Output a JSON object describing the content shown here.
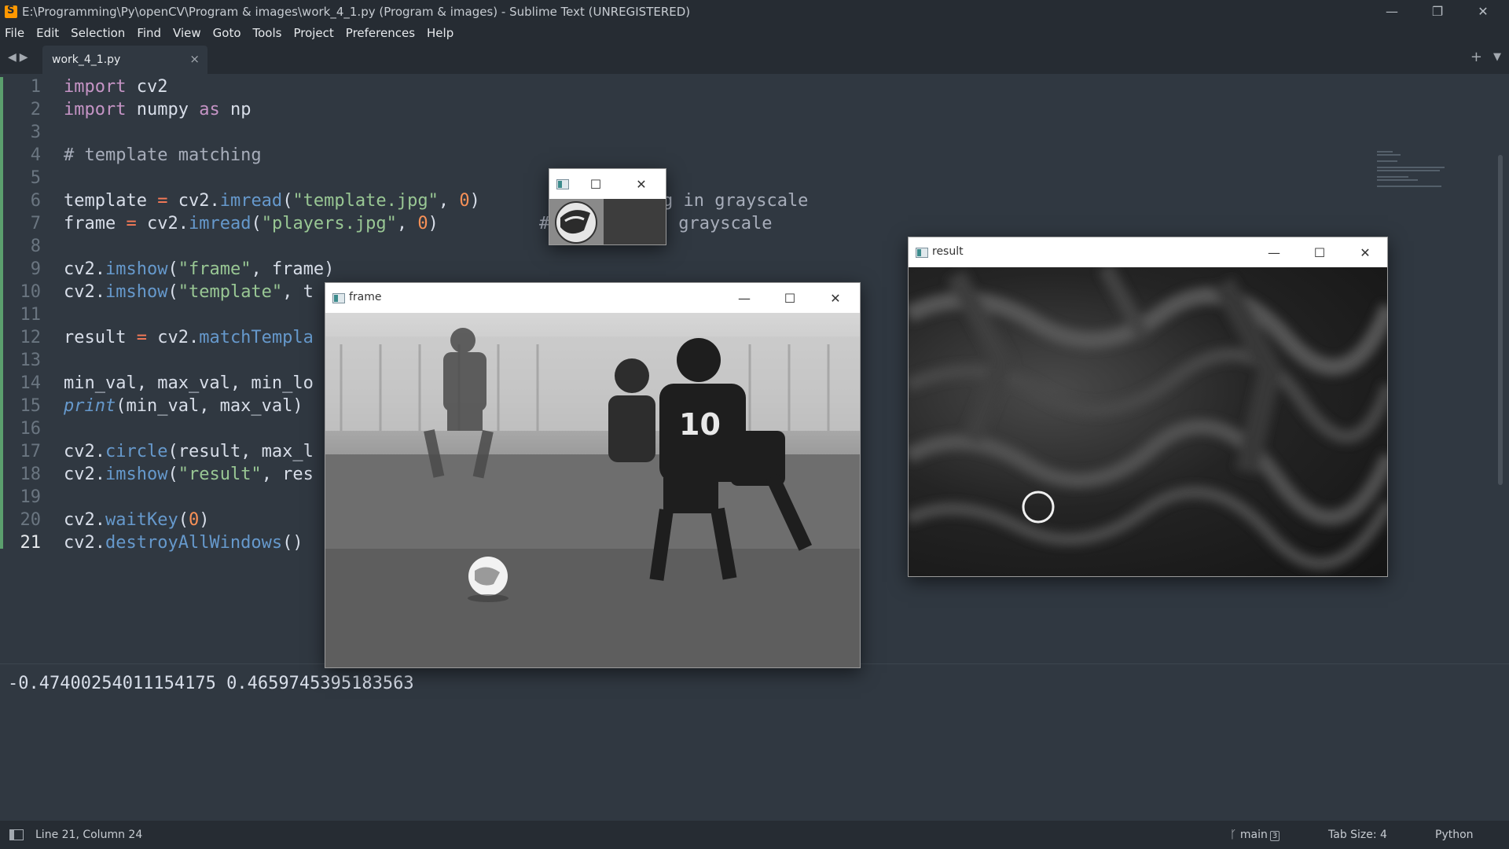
{
  "titlebar": {
    "title": "E:\\Programming\\Py\\openCV\\Program & images\\work_4_1.py (Program & images) - Sublime Text (UNREGISTERED)",
    "minimize_glyph": "—",
    "maximize_glyph": "❐",
    "close_glyph": "✕"
  },
  "menu": [
    "File",
    "Edit",
    "Selection",
    "Find",
    "View",
    "Goto",
    "Tools",
    "Project",
    "Preferences",
    "Help"
  ],
  "tabs": {
    "nav_glyph": "◀▶",
    "active_label": "work_4_1.py",
    "close_glyph": "×",
    "plus_glyph": "+",
    "dropdown_glyph": "▼"
  },
  "editor": {
    "current_line": 21,
    "lines": [
      {
        "n": "1"
      },
      {
        "n": "2"
      },
      {
        "n": "3"
      },
      {
        "n": "4"
      },
      {
        "n": "5"
      },
      {
        "n": "6"
      },
      {
        "n": "7"
      },
      {
        "n": "8"
      },
      {
        "n": "9"
      },
      {
        "n": "10"
      },
      {
        "n": "11"
      },
      {
        "n": "12"
      },
      {
        "n": "13"
      },
      {
        "n": "14"
      },
      {
        "n": "15"
      },
      {
        "n": "16"
      },
      {
        "n": "17"
      },
      {
        "n": "18"
      },
      {
        "n": "19"
      },
      {
        "n": "20"
      },
      {
        "n": "21"
      }
    ],
    "code": {
      "l1": [
        "import",
        " cv2"
      ],
      "l2": [
        "import",
        " numpy ",
        "as",
        " np"
      ],
      "l4": "# template matching",
      "l6": [
        "template ",
        "=",
        " cv2.",
        "imread",
        "(",
        "\"template.jpg\"",
        ", ",
        "0",
        ")",
        "g in grayscale"
      ],
      "l7": [
        "frame ",
        "=",
        " cv2.",
        "imread",
        "(",
        "\"players.jpg\"",
        ", ",
        "0",
        ")",
        "#",
        " grayscale"
      ],
      "l9": [
        "cv2.",
        "imshow",
        "(",
        "\"frame\"",
        ", frame)"
      ],
      "l10": [
        "cv2.",
        "imshow",
        "(",
        "\"template\"",
        ", t"
      ],
      "l12": [
        "result ",
        "=",
        " cv2.",
        "matchTempla"
      ],
      "l14": "min_val, max_val, min_lo",
      "l15": [
        "print",
        "(min_val, max_val)"
      ],
      "l17": [
        "cv2.",
        "circle",
        "(result, max_l"
      ],
      "l18": [
        "cv2.",
        "imshow",
        "(",
        "\"result\"",
        ", res"
      ],
      "l20": [
        "cv2.",
        "waitKey",
        "(",
        "0",
        ")"
      ],
      "l21": [
        "cv2.",
        "destroyAllWindows",
        "()"
      ]
    }
  },
  "output": {
    "text": "-0.47400254011154175 0.4659745395183563"
  },
  "statusbar": {
    "position": "Line 21, Column 24",
    "branch": "main",
    "branch_count": "3",
    "tab_size": "Tab Size: 4",
    "syntax": "Python"
  },
  "windows": {
    "template": {
      "title": ""
    },
    "frame": {
      "title": "frame",
      "jersey_text": "10"
    },
    "result": {
      "title": "result"
    }
  },
  "icons": {
    "app": "sublime-text-icon",
    "cv_window": "opencv-window-icon",
    "branch": "git-branch-icon",
    "panel": "side-panel-icon"
  },
  "colors": {
    "background": "#303841",
    "chrome": "#262c33",
    "keyword": "#c594c5",
    "function": "#6699cc",
    "string": "#99c794",
    "number": "#f99157",
    "operator": "#f97b58",
    "accent": "#ff9800"
  }
}
